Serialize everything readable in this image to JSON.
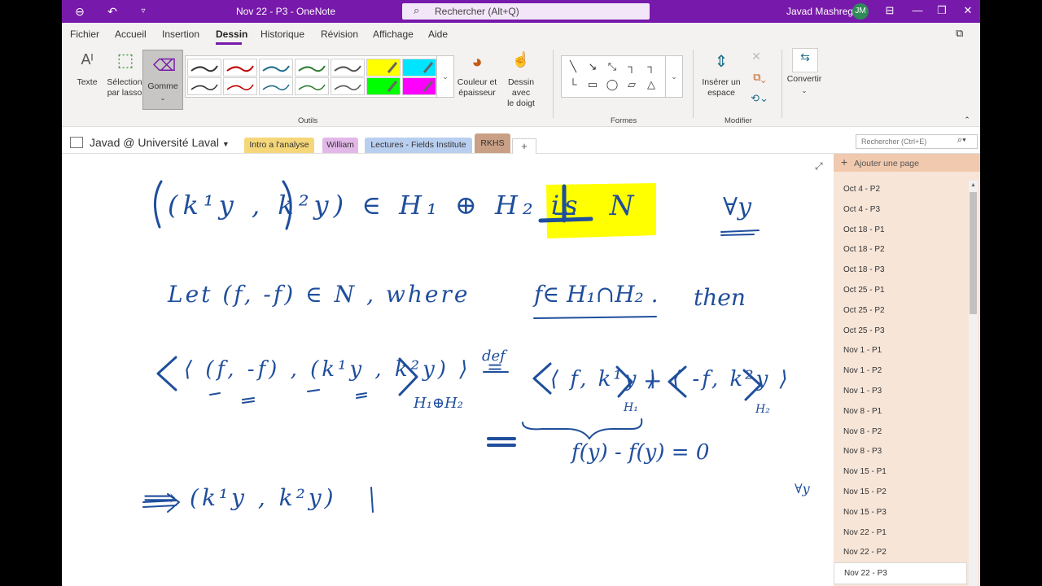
{
  "titlebar": {
    "title": "Nov 22 - P3  -  OneNote",
    "search_placeholder": "Rechercher (Alt+Q)",
    "user_name": "Javad Mashreghi",
    "user_initials": "JM"
  },
  "menu": {
    "items": [
      "Fichier",
      "Accueil",
      "Insertion",
      "Dessin",
      "Historique",
      "Révision",
      "Affichage",
      "Aide"
    ],
    "active": "Dessin"
  },
  "ribbon": {
    "texte": "Texte",
    "selection": "Sélection",
    "selection2": "par lasso",
    "gomme": "Gomme",
    "couleur": "Couleur et",
    "couleur2": "épaisseur",
    "dessin_doigt": "Dessin avec",
    "dessin_doigt2": "le doigt",
    "inserer": "Insérer un",
    "inserer2": "espace",
    "convertir": "Convertir",
    "group_outils": "Outils",
    "group_formes": "Formes",
    "group_modifier": "Modifier",
    "pen_colors": [
      "#333333",
      "#c00000",
      "#1f6f8b",
      "#2e7d32",
      "#555555",
      "#ffff00",
      "#00e5ff",
      "#333333",
      "#c00000",
      "#1f6f8b",
      "#2e7d32",
      "#555555",
      "#00ff00",
      "#ff00ff"
    ]
  },
  "notebook": {
    "name": "Javad @ Université Laval",
    "sections": [
      {
        "label": "Intro a l'analyse",
        "color": "#f5d77a"
      },
      {
        "label": "William",
        "color": "#e2b8e8"
      },
      {
        "label": "Lectures - Fields Institute",
        "color": "#b9cff0"
      },
      {
        "label": "RKHS",
        "color": "#c9a086"
      }
    ],
    "page_search_placeholder": "Rechercher (Ctrl+E)"
  },
  "pages": {
    "add_label": "Ajouter une page",
    "items": [
      "Oct 4 - P2",
      "Oct 4 - P3",
      "Oct 18 - P1",
      "Oct 18 - P2",
      "Oct 18 - P3",
      "Oct 25 - P1",
      "Oct 25 - P2",
      "Oct 25 - P3",
      "Nov 1 - P1",
      "Nov 1 - P2",
      "Nov 1 - P3",
      "Nov 8 - P1",
      "Nov 8 - P2",
      "Nov 8 - P3",
      "Nov 15 - P1",
      "Nov 15 - P2",
      "Nov 15 - P3",
      "Nov 22 - P1",
      "Nov 22 - P2",
      "Nov 22 - P3"
    ],
    "selected": "Nov 22 - P3"
  },
  "ink": {
    "color": "#1f4e9c",
    "line1": "(k¹y , k²y) ∈ H₁ ⊕ H₂   is",
    "perp": "⊥ N",
    "forall1": "∀y",
    "line2a": "Let  (f, -f) ∈ N  , where",
    "line2b": "f∈ H₁∩H₂ .",
    "line2c": "then",
    "line3a": "⟨ (f, -f) , (k¹y , k²y) ⟩",
    "line3sub": "H₁⊕H₂",
    "def": "def",
    "eq": "=",
    "line3b": "⟨ f, k¹y ⟩",
    "sub_h1": "H₁",
    "plus": "+",
    "line3c": "⟨ -f, k²y ⟩",
    "sub_h2": "H₂",
    "line4eq": "=",
    "line4": "f(y)   -   f(y)  = 0",
    "forall2": "∀y",
    "line5": "⟹  (k¹y , k²y)",
    "bar": "|"
  }
}
